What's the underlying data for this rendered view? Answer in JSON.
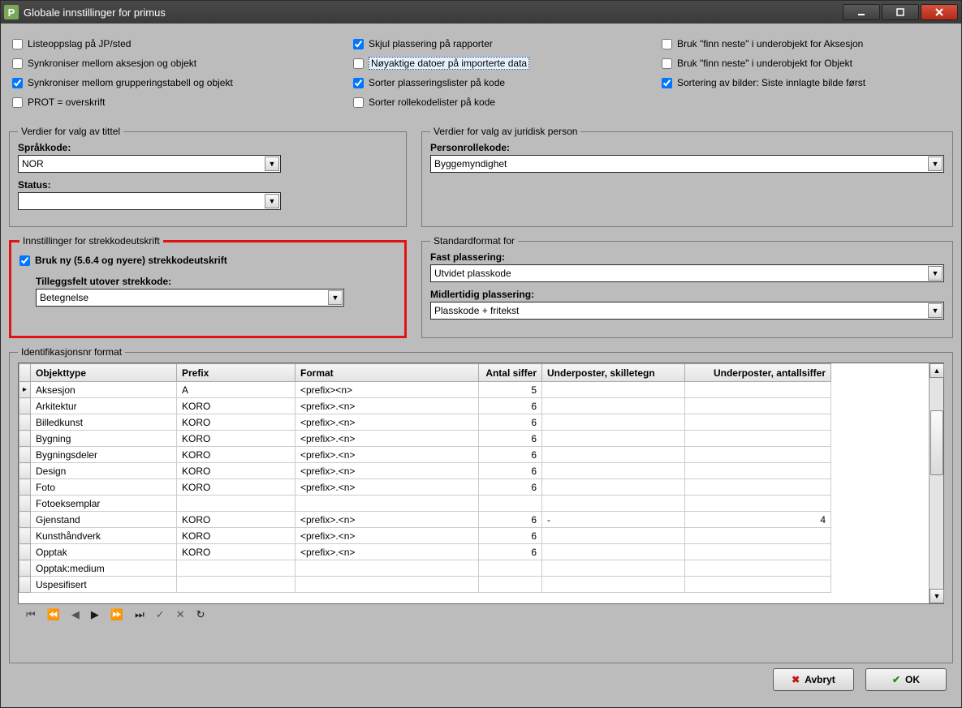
{
  "window": {
    "title": "Globale innstillinger for primus"
  },
  "checks": {
    "c1": {
      "label": "Listeoppslag på JP/sted",
      "checked": false
    },
    "c2": {
      "label": "Synkroniser mellom aksesjon og objekt",
      "checked": false
    },
    "c3": {
      "label": "Synkroniser mellom grupperingstabell  og objekt",
      "checked": true
    },
    "c4": {
      "label": "PROT = overskrift",
      "checked": false
    },
    "c5": {
      "label": "Skjul plassering på rapporter",
      "checked": true
    },
    "c6": {
      "label": "Nøyaktige datoer på importerte data",
      "checked": false
    },
    "c7": {
      "label": "Sorter plasseringslister på kode",
      "checked": true
    },
    "c8": {
      "label": "Sorter rollekodelister på kode",
      "checked": false
    },
    "c9": {
      "label": "Bruk \"finn neste\"  i underobjekt for Aksesjon",
      "checked": false
    },
    "c10": {
      "label": "Bruk \"finn neste\"  i underobjekt for Objekt",
      "checked": false
    },
    "c11": {
      "label": "Sortering av bilder: Siste innlagte bilde først",
      "checked": true
    }
  },
  "tittel": {
    "legend": "Verdier for valg av tittel",
    "sprak_label": "Språkkode:",
    "sprak_value": "NOR",
    "status_label": "Status:",
    "status_value": ""
  },
  "juridisk": {
    "legend": "Verdier for valg av juridisk person",
    "personrolle_label": "Personrollekode:",
    "personrolle_value": "Byggemyndighet"
  },
  "strekkode": {
    "legend": "Innstillinger for strekkodeutskrift",
    "brukny_label": "Bruk ny (5.6.4 og nyere) strekkodeutskrift",
    "brukny_checked": true,
    "tillegg_label": "Tilleggsfelt utover strekkode:",
    "tillegg_value": "Betegnelse"
  },
  "standardformat": {
    "legend": "Standardformat for",
    "fast_label": "Fast plassering:",
    "fast_value": "Utvidet plasskode",
    "midl_label": "Midlertidig plassering:",
    "midl_value": "Plasskode + fritekst"
  },
  "idformat": {
    "legend": "Identifikasjonsnr format",
    "headers": {
      "objekttype": "Objekttype",
      "prefix": "Prefix",
      "format": "Format",
      "antal": "Antal siffer",
      "skille": "Underposter, skilletegn",
      "antall": "Underposter, antallsiffer"
    },
    "rows": [
      {
        "objekttype": "Aksesjon",
        "prefix": "A",
        "format": "<prefix><n>",
        "antal": "5",
        "skille": "",
        "antall": ""
      },
      {
        "objekttype": "Arkitektur",
        "prefix": "KORO",
        "format": "<prefix>.<n>",
        "antal": "6",
        "skille": "",
        "antall": ""
      },
      {
        "objekttype": "Billedkunst",
        "prefix": "KORO",
        "format": "<prefix>.<n>",
        "antal": "6",
        "skille": "",
        "antall": ""
      },
      {
        "objekttype": "Bygning",
        "prefix": "KORO",
        "format": "<prefix>.<n>",
        "antal": "6",
        "skille": "",
        "antall": ""
      },
      {
        "objekttype": "Bygningsdeler",
        "prefix": "KORO",
        "format": "<prefix>.<n>",
        "antal": "6",
        "skille": "",
        "antall": ""
      },
      {
        "objekttype": "Design",
        "prefix": "KORO",
        "format": "<prefix>.<n>",
        "antal": "6",
        "skille": "",
        "antall": ""
      },
      {
        "objekttype": "Foto",
        "prefix": "KORO",
        "format": "<prefix>.<n>",
        "antal": "6",
        "skille": "",
        "antall": ""
      },
      {
        "objekttype": "Fotoeksemplar",
        "prefix": "",
        "format": "",
        "antal": "",
        "skille": "",
        "antall": ""
      },
      {
        "objekttype": "Gjenstand",
        "prefix": "KORO",
        "format": "<prefix>.<n>",
        "antal": "6",
        "skille": "-",
        "antall": "4"
      },
      {
        "objekttype": "Kunsthåndverk",
        "prefix": "KORO",
        "format": "<prefix>.<n>",
        "antal": "6",
        "skille": "",
        "antall": ""
      },
      {
        "objekttype": "Opptak",
        "prefix": "KORO",
        "format": "<prefix>.<n>",
        "antal": "6",
        "skille": "",
        "antall": ""
      },
      {
        "objekttype": "Opptak:medium",
        "prefix": "",
        "format": "",
        "antal": "",
        "skille": "",
        "antall": ""
      },
      {
        "objekttype": "Uspesifisert",
        "prefix": "",
        "format": "",
        "antal": "",
        "skille": "",
        "antall": ""
      }
    ]
  },
  "footer": {
    "avbryt": "Avbryt",
    "ok": "OK"
  }
}
